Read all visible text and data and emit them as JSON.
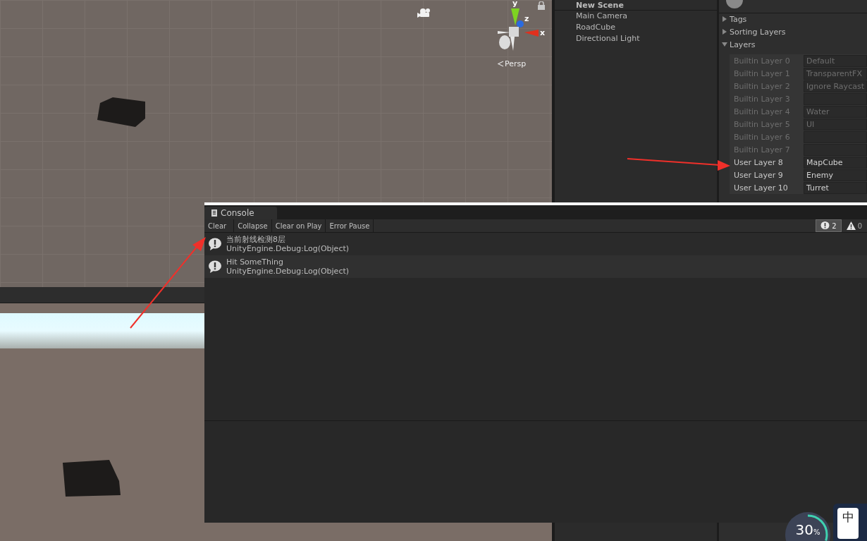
{
  "scene": {
    "axes": [
      "y",
      "z",
      "x"
    ],
    "projection": "Persp"
  },
  "hierarchy": {
    "scene": "New Scene",
    "items": [
      "Main Camera",
      "RoadCube",
      "Directional Light"
    ]
  },
  "inspector": {
    "sections": [
      {
        "label": "Tags",
        "expanded": false
      },
      {
        "label": "Sorting Layers",
        "expanded": false
      },
      {
        "label": "Layers",
        "expanded": true
      }
    ],
    "layers": [
      {
        "label": "Builtin Layer 0",
        "value": "Default",
        "disabled": true
      },
      {
        "label": "Builtin Layer 1",
        "value": "TransparentFX",
        "disabled": true
      },
      {
        "label": "Builtin Layer 2",
        "value": "Ignore Raycast",
        "disabled": true
      },
      {
        "label": "Builtin Layer 3",
        "disabled": true
      },
      {
        "label": "Builtin Layer 4",
        "value": "Water",
        "disabled": true
      },
      {
        "label": "Builtin Layer 5",
        "value": "UI",
        "disabled": true
      },
      {
        "label": "Builtin Layer 6",
        "disabled": true
      },
      {
        "label": "Builtin Layer 7",
        "disabled": true
      },
      {
        "label": "User Layer 8",
        "value": "MapCube",
        "disabled": false
      },
      {
        "label": "User Layer 9",
        "value": "Enemy",
        "disabled": false
      },
      {
        "label": "User Layer 10",
        "value": "Turret",
        "disabled": false
      }
    ]
  },
  "console": {
    "title": "Console",
    "toolbar": [
      "Clear",
      "Collapse",
      "Clear on Play",
      "Error Pause"
    ],
    "counts": [
      {
        "kind": "info",
        "count": "2",
        "selected": true
      },
      {
        "kind": "warning",
        "count": "0",
        "selected": false
      }
    ],
    "entries": [
      {
        "kind": "info",
        "message": "当前射线检测8层",
        "trace": "UnityEngine.Debug:Log(Object)"
      },
      {
        "kind": "info",
        "message": "Hit SomeThing",
        "trace": "UnityEngine.Debug:Log(Object)"
      }
    ]
  },
  "overlay": {
    "progress": "30",
    "unit": "%",
    "level": 0.3,
    "ime": "中"
  }
}
